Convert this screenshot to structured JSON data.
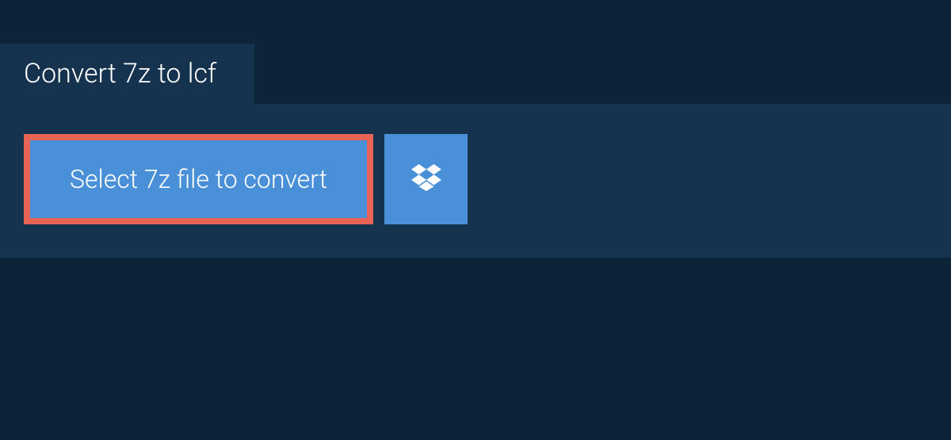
{
  "tab": {
    "label": "Convert 7z to lcf"
  },
  "main": {
    "select_button_label": "Select 7z file to convert",
    "dropbox_icon": "dropbox"
  }
}
